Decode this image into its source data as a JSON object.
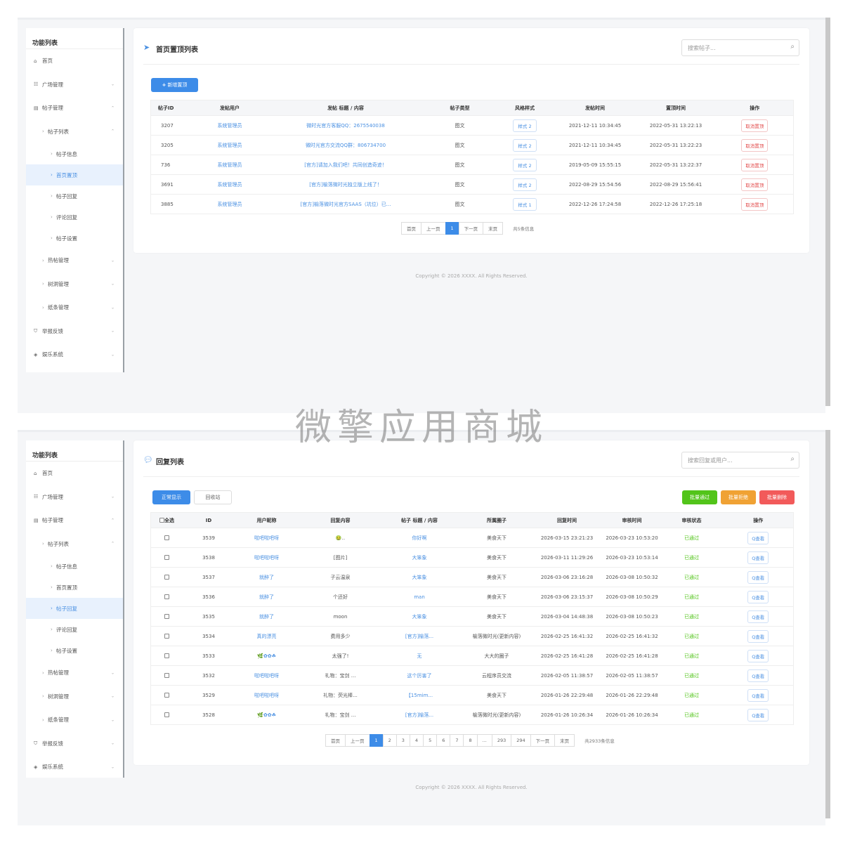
{
  "watermark": "微擎应用商城",
  "sidebar": {
    "title": "功能列表",
    "items": [
      {
        "label": "首页",
        "icon": "home-icon"
      },
      {
        "label": "广场管理",
        "icon": "grid-icon"
      },
      {
        "label": "帖子管理",
        "icon": "file-icon"
      },
      {
        "label": "帖子列表",
        "icon": "chevron-right-icon"
      },
      {
        "label": "帖子信息",
        "icon": "chevron-right-icon"
      },
      {
        "label": "首页置顶",
        "icon": "chevron-right-icon"
      },
      {
        "label": "帖子回复",
        "icon": "chevron-right-icon"
      },
      {
        "label": "评论回复",
        "icon": "chevron-right-icon"
      },
      {
        "label": "帖子设置",
        "icon": "chevron-right-icon"
      },
      {
        "label": "热帖管理",
        "icon": "chevron-right-icon"
      },
      {
        "label": "树洞管理",
        "icon": "chevron-right-icon"
      },
      {
        "label": "纸条管理",
        "icon": "chevron-right-icon"
      },
      {
        "label": "举报反馈",
        "icon": "shield-icon"
      },
      {
        "label": "娱乐系统",
        "icon": "tags-icon"
      }
    ]
  },
  "pinned": {
    "title": "首页置顶列表",
    "search_placeholder": "搜索帖子...",
    "add_button": "新增置顶",
    "columns": [
      "帖子ID",
      "发帖用户",
      "发帖 标题 / 内容",
      "帖子类型",
      "风格样式",
      "发帖时间",
      "置顶时间",
      "操作"
    ],
    "rows": [
      {
        "id": "3207",
        "user": "系统管理员",
        "content": "微时光官方客服QQ：2675540038",
        "type": "图文",
        "style": "样式 2",
        "post_time": "2021-12-11 10:34:45",
        "pin_time": "2022-05-31 13:22:13",
        "action": "取消置顶"
      },
      {
        "id": "3205",
        "user": "系统管理员",
        "content": "微时光官方交流QQ群：806734700",
        "type": "图文",
        "style": "样式 2",
        "post_time": "2021-12-11 10:34:45",
        "pin_time": "2022-05-31 13:22:23",
        "action": "取消置顶"
      },
      {
        "id": "736",
        "user": "系统管理员",
        "content": "[官方]请加入我们吧！共同创造奇迹！",
        "type": "图文",
        "style": "样式 2",
        "post_time": "2019-05-09 15:55:15",
        "pin_time": "2022-05-31 13:22:37",
        "action": "取消置顶"
      },
      {
        "id": "3691",
        "user": "系统管理员",
        "content": "[官方]榆落微时光独立版上线了！",
        "type": "图文",
        "style": "样式 2",
        "post_time": "2022-08-29 15:54:56",
        "pin_time": "2022-08-29 15:56:41",
        "action": "取消置顶"
      },
      {
        "id": "3885",
        "user": "系统管理员",
        "content": "[官方]榆落微时光官方SAAS（坑位）已...",
        "type": "图文",
        "style": "样式 1",
        "post_time": "2022-12-26 17:24:58",
        "pin_time": "2022-12-26 17:25:18",
        "action": "取消置顶"
      }
    ],
    "pager": {
      "first": "首页",
      "prev": "上一页",
      "current": "1",
      "next": "下一页",
      "last": "末页",
      "total": "共5条信息"
    },
    "copyright": "Copyright © 2026 XXXX. All Rights Reserved."
  },
  "replies": {
    "title": "回复列表",
    "search_placeholder": "搜索回复或用户...",
    "tab_normal": "正常显示",
    "tab_recycle": "回收站",
    "batch_pass": "批量通过",
    "batch_reject": "批量拒绝",
    "batch_delete": "批量删除",
    "columns": [
      "全选",
      "ID",
      "用户昵称",
      "回复内容",
      "帖子 标题 / 内容",
      "所属圈子",
      "回复时间",
      "审核时间",
      "审核状态",
      "操作"
    ],
    "rows": [
      {
        "id": "3539",
        "user": "啦吧啦吧呀",
        "content": "🤢..",
        "post": "你好啊",
        "circle": "美食天下",
        "reply_time": "2026-03-15 23:21:23",
        "audit_time": "2026-03-23 10:53:20",
        "status": "已通过",
        "action": "Q查看"
      },
      {
        "id": "3538",
        "user": "啦吧啦吧呀",
        "content": "[图片]",
        "post": "大笨象",
        "circle": "美食天下",
        "reply_time": "2026-03-11 11:29:26",
        "audit_time": "2026-03-23 10:53:14",
        "status": "已通过",
        "action": "Q查看"
      },
      {
        "id": "3537",
        "user": "就醉了",
        "content": "子云温泉",
        "post": "大笨象",
        "circle": "美食天下",
        "reply_time": "2026-03-06 23:16:28",
        "audit_time": "2026-03-08 10:50:32",
        "status": "已通过",
        "action": "Q查看"
      },
      {
        "id": "3536",
        "user": "就醉了",
        "content": "个还好",
        "post": "man",
        "circle": "美食天下",
        "reply_time": "2026-03-06 23:15:37",
        "audit_time": "2026-03-08 10:50:29",
        "status": "已通过",
        "action": "Q查看"
      },
      {
        "id": "3535",
        "user": "就醉了",
        "content": "moon",
        "post": "大笨象",
        "circle": "美食天下",
        "reply_time": "2026-03-04 14:48:38",
        "audit_time": "2026-03-08 10:50:23",
        "status": "已通过",
        "action": "Q查看"
      },
      {
        "id": "3534",
        "user": "真的漂亮",
        "content": "费用多少",
        "post": "[官方]榆落...",
        "circle": "榆落微时光(更新内容)",
        "reply_time": "2026-02-25 16:41:32",
        "audit_time": "2026-02-25 16:41:32",
        "status": "已通过",
        "action": "Q查看"
      },
      {
        "id": "3533",
        "user": "🌿✿✿☘",
        "content": "太强了!",
        "post": "无",
        "circle": "大大的圈子",
        "reply_time": "2026-02-25 16:41:28",
        "audit_time": "2026-02-25 16:41:28",
        "status": "已通过",
        "action": "Q查看"
      },
      {
        "id": "3532",
        "user": "啦吧啦吧呀",
        "content": "礼物：宝剑 ...",
        "post": "这个厉害了",
        "circle": "云程序员交流",
        "reply_time": "2026-02-05 11:38:57",
        "audit_time": "2026-02-05 11:38:57",
        "status": "已通过",
        "action": "Q查看"
      },
      {
        "id": "3529",
        "user": "啦吧啦吧呀",
        "content": "礼物：荧光棒...",
        "post": "【15mim...",
        "circle": "美食天下",
        "reply_time": "2026-01-26 22:29:48",
        "audit_time": "2026-01-26 22:29:48",
        "status": "已通过",
        "action": "Q查看"
      },
      {
        "id": "3528",
        "user": "🌿✿✿☘",
        "content": "礼物：宝剑 ...",
        "post": "[官方]榆落...",
        "circle": "榆落微时光(更新内容)",
        "reply_time": "2026-01-26 10:26:34",
        "audit_time": "2026-01-26 10:26:34",
        "status": "已通过",
        "action": "Q查看"
      }
    ],
    "pager": {
      "first": "首页",
      "prev": "上一页",
      "pages": [
        "1",
        "2",
        "3",
        "4",
        "5",
        "6",
        "7",
        "8",
        "...",
        "293",
        "294"
      ],
      "next": "下一页",
      "last": "末页",
      "total": "共2933条信息"
    },
    "copyright": "Copyright © 2026 XXXX. All Rights Reserved."
  },
  "colors": {
    "accent": "#3d8ce8",
    "success": "#52c41a",
    "warning": "#f0a234",
    "danger": "#f25a5a"
  }
}
